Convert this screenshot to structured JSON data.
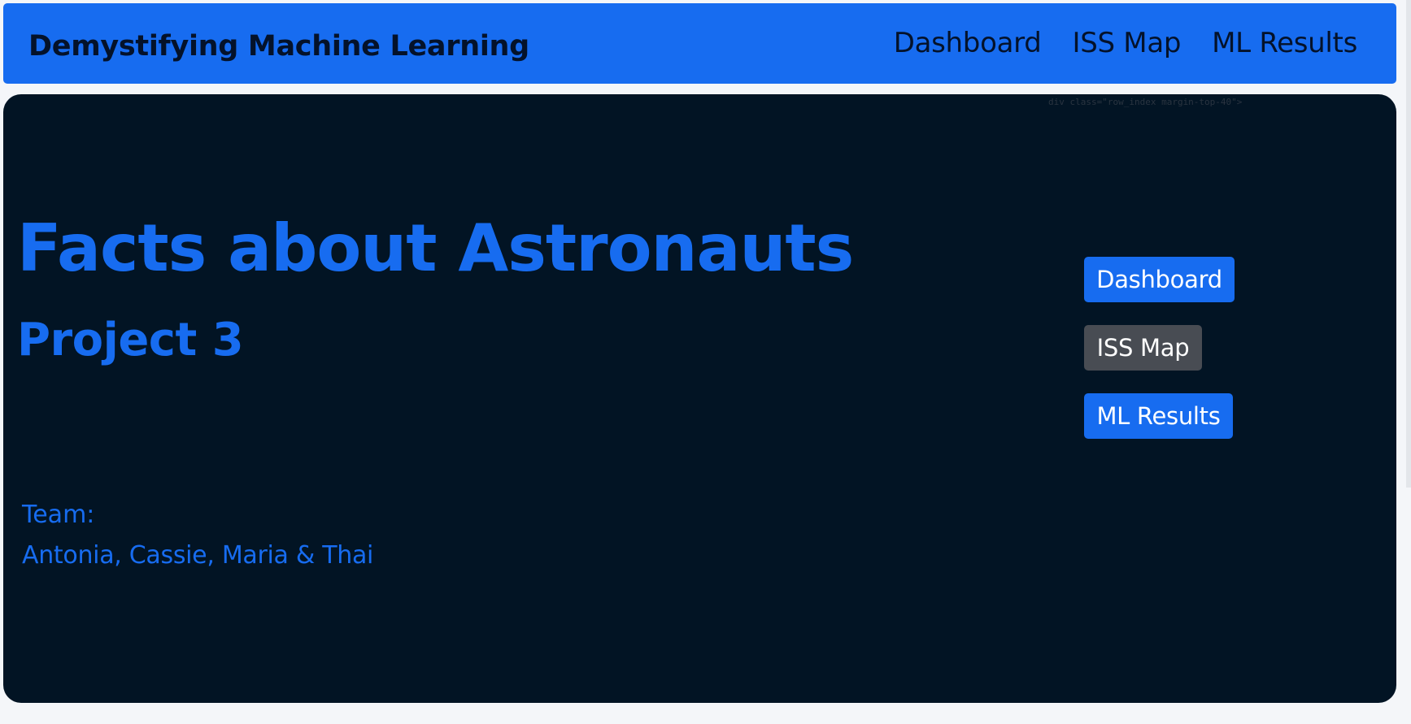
{
  "navbar": {
    "brand": "Demystifying Machine Learning",
    "links": [
      "Dashboard",
      "ISS Map",
      "ML Results"
    ]
  },
  "hero": {
    "comment": "div class=\"row_index margin-top-40\">",
    "title": "Facts about Astronauts",
    "subtitle": "Project 3",
    "team_label": "Team:",
    "team_members": "Antonia, Cassie, Maria & Thai",
    "buttons": [
      {
        "label": "Dashboard",
        "style": "primary"
      },
      {
        "label": "ISS Map",
        "style": "secondary"
      },
      {
        "label": "ML Results",
        "style": "primary"
      }
    ]
  },
  "colors": {
    "brand_blue": "#176cf0",
    "hero_background": "#021424",
    "navbar_text": "#04122a",
    "secondary_button": "#484c53"
  }
}
